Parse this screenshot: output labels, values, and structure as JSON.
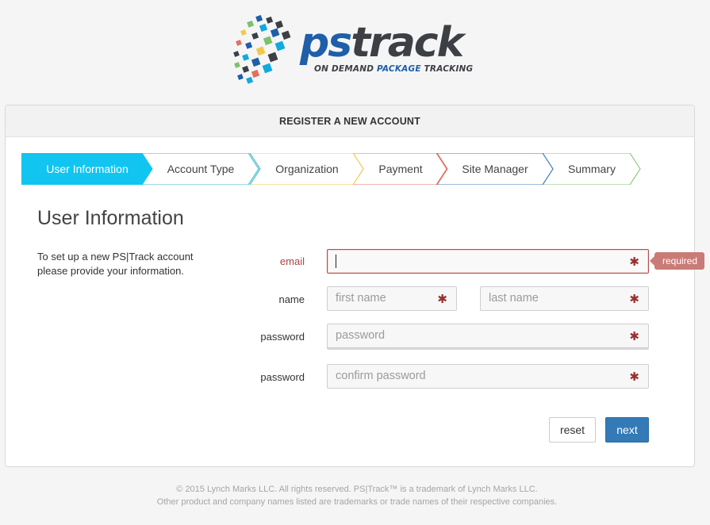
{
  "brand": {
    "name_ps": "ps",
    "name_track": "track",
    "tagline_pre": "ON DEMAND ",
    "tagline_hl": "PACKAGE",
    "tagline_post": " TRACKING",
    "colors": {
      "primary": "#1f5ea8",
      "dark": "#3c3f44"
    }
  },
  "panel": {
    "title": "REGISTER A NEW ACCOUNT"
  },
  "steps": [
    {
      "label": "User Information",
      "active": true,
      "color": "#11c5f0"
    },
    {
      "label": "Account Type",
      "active": false,
      "color": "#2fb6c6"
    },
    {
      "label": "Organization",
      "active": false,
      "color": "#f0c94a"
    },
    {
      "label": "Payment",
      "active": false,
      "color": "#e0705f"
    },
    {
      "label": "Site Manager",
      "active": false,
      "color": "#337ab7"
    },
    {
      "label": "Summary",
      "active": false,
      "color": "#7cc16e"
    }
  ],
  "section": {
    "title": "User Information",
    "intro": "To set up a new PS|Track account please provide your information."
  },
  "form": {
    "email_label": "email",
    "email_value": "",
    "name_label": "name",
    "first_name_placeholder": "first name",
    "last_name_placeholder": "last name",
    "password_label": "password",
    "password_placeholder": "password",
    "confirm_label": "password",
    "confirm_placeholder": "confirm password",
    "required_marker": "✱",
    "required_tip": "required"
  },
  "buttons": {
    "reset": "reset",
    "next": "next"
  },
  "footer": {
    "line1": "© 2015 Lynch Marks LLC. All rights reserved. PS|Track™ is a trademark of Lynch Marks LLC.",
    "line2": "Other product and company names listed are trademarks or trade names of their respective companies."
  }
}
